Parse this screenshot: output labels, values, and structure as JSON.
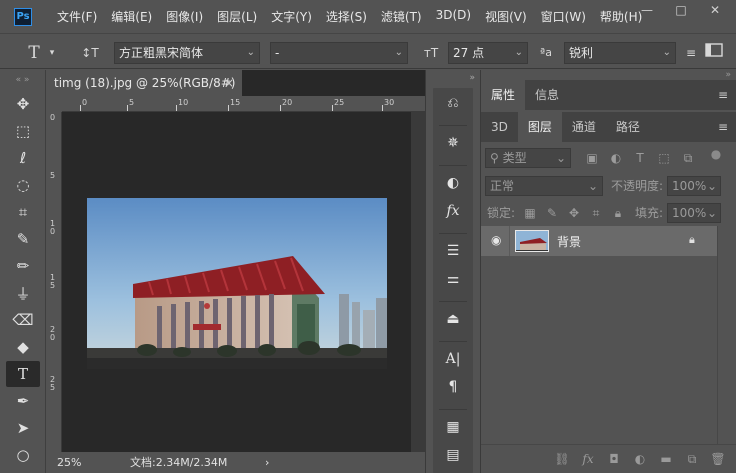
{
  "menubar": {
    "logo": "Ps",
    "items": [
      "文件(F)",
      "编辑(E)",
      "图像(I)",
      "图层(L)",
      "文字(Y)",
      "选择(S)",
      "滤镜(T)",
      "3D(D)",
      "视图(V)",
      "窗口(W)",
      "帮助(H)"
    ],
    "window_controls": [
      "—",
      "□",
      "✕"
    ]
  },
  "optionsbar": {
    "tool_icon": "T",
    "orient_icon": "↕T",
    "font_family": "方正粗黑宋简体",
    "font_style": "-",
    "size_icon": "тT",
    "font_size": "27 点",
    "aa_icon": "ªa",
    "antialias": "锐利"
  },
  "document": {
    "tab_title": "timg (18).jpg @ 25%(RGB/8#)",
    "close": "×",
    "ruler_h_ticks": [
      "0",
      "5",
      "10",
      "15",
      "20",
      "25",
      "30"
    ],
    "ruler_v_ticks": [
      "0",
      "5",
      "1\n0",
      "1\n5",
      "2\n0",
      "2\n5"
    ],
    "zoom": "25%",
    "doc_info": "文档:2.34M/2.34M",
    "doc_info_arrow": "›"
  },
  "panels": {
    "properties_tabs": [
      "属性",
      "信息"
    ],
    "layer_tabs": [
      "3D",
      "图层",
      "通道",
      "路径"
    ],
    "filter_kind": "类型",
    "blend_mode": "正常",
    "opacity_label": "不透明度:",
    "opacity_value": "100%",
    "lock_label": "锁定:",
    "fill_label": "填充:",
    "fill_value": "100%",
    "layer_name": "背景",
    "menu_icon": "≡"
  },
  "colors": {
    "ui_bg": "#535353",
    "canvas_bg": "#282828",
    "tab_bg": "#424242",
    "accent": "#2f8fe8"
  }
}
